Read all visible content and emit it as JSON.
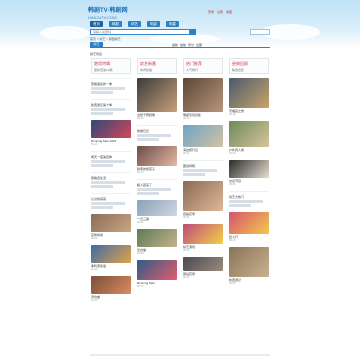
{
  "header": {
    "logo_text": "韩剧TV·韩剧网",
    "logo_sub": "HANJUTV.COM",
    "top_links": [
      "登录",
      "注册",
      "收藏"
    ]
  },
  "nav": {
    "items": [
      "首页",
      "韩剧",
      "综艺",
      "电影",
      "明星"
    ]
  },
  "search": {
    "placeholder": "请输入关键词"
  },
  "breadcrumb": "首页 > 综艺 > 韩国综艺",
  "filter": {
    "tab_label": "综艺",
    "links": [
      "最新",
      "最热",
      "评分",
      "全部"
    ]
  },
  "section_label": "综艺列表",
  "columns": [
    {
      "title": "跑男特辑",
      "subtitle": "更新至第12期",
      "cards": [
        {
          "kind": "text",
          "title": "家族诞生新一季"
        },
        {
          "kind": "text",
          "title": "新西游记第十季"
        },
        {
          "kind": "image",
          "title": "Running Man 2023",
          "meta": "09-21",
          "color": "#2c4a78",
          "accent": "#d6455a",
          "h": 18
        },
        {
          "kind": "text",
          "title": "两天一夜第四季"
        },
        {
          "kind": "text",
          "title": "我独自生活"
        },
        {
          "kind": "text",
          "title": "认识的哥哥"
        },
        {
          "kind": "image",
          "title": "花样青春",
          "meta": "08-30",
          "color": "#8a6e5a",
          "accent": "#c9a680",
          "h": 18
        },
        {
          "kind": "image",
          "title": "孝利家民宿",
          "meta": "08-22",
          "color": "#3f6aa6",
          "accent": "#e2a34a",
          "h": 18
        },
        {
          "kind": "image",
          "title": "尹食堂",
          "meta": "08-10",
          "color": "#7a4f3a",
          "accent": "#d98c5f",
          "h": 18
        }
      ]
    },
    {
      "title": "综艺新番",
      "subtitle": "本周热播",
      "cards": [
        {
          "kind": "image",
          "title": "全知干预视角",
          "meta": "09-20",
          "color": "#3b3b3b",
          "accent": "#c8a07a",
          "h": 34
        },
        {
          "kind": "text",
          "title": "新婚日记"
        },
        {
          "kind": "image",
          "title": "我家的熊孩子",
          "meta": "09-12",
          "color": "#6b4c4a",
          "accent": "#e6b8a2",
          "h": 20
        },
        {
          "kind": "text",
          "title": "超人回来了"
        },
        {
          "kind": "image",
          "title": "一日三餐",
          "meta": "09-02",
          "color": "#8aa0b8",
          "accent": "#d0d8e2",
          "h": 16
        },
        {
          "kind": "image",
          "title": "姜食堂",
          "meta": "08-28",
          "color": "#5e7a58",
          "accent": "#c4b28c",
          "h": 18
        },
        {
          "kind": "image",
          "title": "Running Man",
          "meta": "08-15",
          "color": "#2e5c8a",
          "accent": "#e35d6a",
          "h": 20
        }
      ]
    },
    {
      "title": "热门推荐",
      "subtitle": "人气排行",
      "cards": [
        {
          "kind": "image",
          "title": "明星写真合集",
          "meta": "09-19",
          "color": "#5a4636",
          "accent": "#b8977a",
          "h": 34
        },
        {
          "kind": "image",
          "title": "海边旅行记",
          "meta": "09-11",
          "color": "#6fa3c8",
          "accent": "#d4c3a0",
          "h": 22
        },
        {
          "kind": "text",
          "title": "团综特辑"
        },
        {
          "kind": "image",
          "title": "自拍花絮",
          "meta": "08-31",
          "color": "#8a6a55",
          "accent": "#e0b896",
          "h": 30
        },
        {
          "kind": "image",
          "title": "综艺游戏",
          "meta": "08-20",
          "color": "#c04a7a",
          "accent": "#f0d24a",
          "h": 20
        },
        {
          "kind": "image",
          "title": "幕后花絮",
          "meta": "08-12",
          "color": "#4a4a52",
          "accent": "#9a8a7a",
          "h": 14
        }
      ]
    },
    {
      "title": "经典回顾",
      "subtitle": "精选合集",
      "cards": [
        {
          "kind": "image",
          "title": "景福宫之旅",
          "meta": "09-18",
          "color": "#4a5a6e",
          "accent": "#c9a36a",
          "h": 30
        },
        {
          "kind": "image",
          "title": "户外真人秀",
          "meta": "09-09",
          "color": "#6c8a5a",
          "accent": "#d8c49a",
          "h": 26
        },
        {
          "kind": "image",
          "title": "访谈节目",
          "meta": "08-29",
          "color": "#2a2a2a",
          "accent": "#e8e0d0",
          "h": 18
        },
        {
          "kind": "text",
          "title": "综艺大热门"
        },
        {
          "kind": "image",
          "title": "四人行",
          "meta": "08-18",
          "color": "#d6546e",
          "accent": "#f2c84c",
          "h": 22
        },
        {
          "kind": "image",
          "title": "新西游记",
          "meta": "08-06",
          "color": "#8a7258",
          "accent": "#c9b290",
          "h": 30
        }
      ]
    }
  ]
}
